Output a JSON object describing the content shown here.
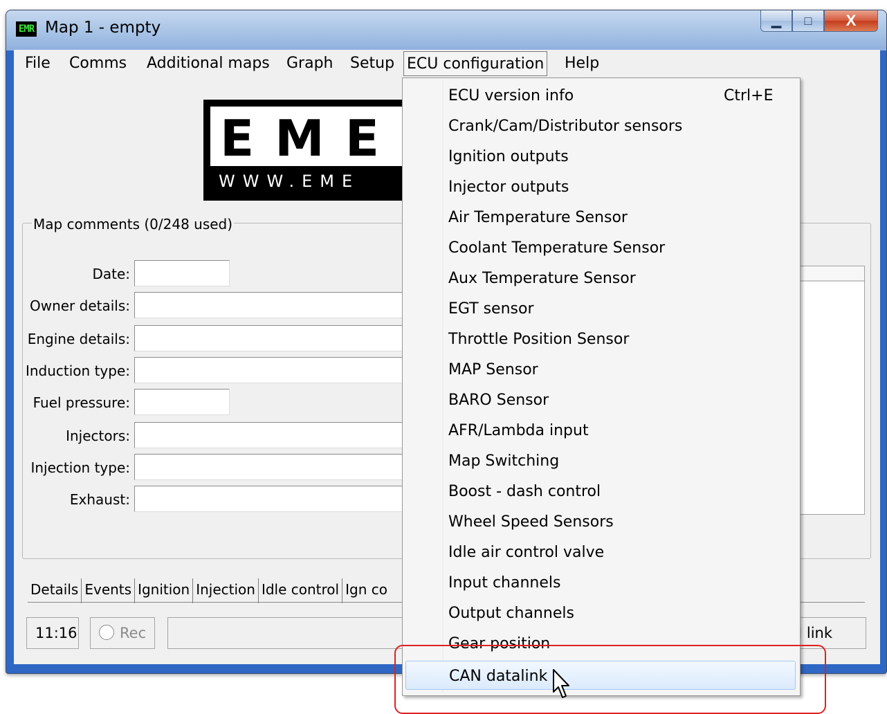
{
  "window": {
    "icon_text": "EMR",
    "title": "Map 1 - empty",
    "minimize_glyph": "▁",
    "maximize_glyph": "□",
    "close_glyph": "X"
  },
  "menu": {
    "items": [
      "File",
      "Comms",
      "Additional maps",
      "Graph",
      "Setup",
      "ECU configuration",
      "Help"
    ],
    "active": "ECU configuration"
  },
  "logo": {
    "letters": "EME",
    "url": "WWW.EME"
  },
  "map_comments": {
    "legend": "Map comments (0/248 used)",
    "fields": [
      {
        "label": "Date:",
        "value": ""
      },
      {
        "label": "Owner details:",
        "value": ""
      },
      {
        "label": "Engine details:",
        "value": ""
      },
      {
        "label": "Induction type:",
        "value": ""
      },
      {
        "label": "Fuel pressure:",
        "value": ""
      },
      {
        "label": "Injectors:",
        "value": ""
      },
      {
        "label": "Injection type:",
        "value": ""
      },
      {
        "label": "Exhaust:",
        "value": ""
      }
    ]
  },
  "tabs": [
    "Details",
    "Events",
    "Ignition",
    "Injection",
    "Idle control",
    "Ign co"
  ],
  "status": {
    "time": "11:16",
    "rec_label": "Rec",
    "link_text": "J link"
  },
  "dropdown": {
    "items": [
      {
        "label": "ECU version info",
        "shortcut": "Ctrl+E"
      },
      {
        "label": "Crank/Cam/Distributor sensors",
        "shortcut": ""
      },
      {
        "label": "Ignition outputs",
        "shortcut": ""
      },
      {
        "label": "Injector outputs",
        "shortcut": ""
      },
      {
        "label": "Air Temperature Sensor",
        "shortcut": ""
      },
      {
        "label": "Coolant Temperature Sensor",
        "shortcut": ""
      },
      {
        "label": "Aux Temperature Sensor",
        "shortcut": ""
      },
      {
        "label": "EGT sensor",
        "shortcut": ""
      },
      {
        "label": "Throttle Position Sensor",
        "shortcut": ""
      },
      {
        "label": "MAP Sensor",
        "shortcut": ""
      },
      {
        "label": "BARO Sensor",
        "shortcut": ""
      },
      {
        "label": "AFR/Lambda input",
        "shortcut": ""
      },
      {
        "label": "Map Switching",
        "shortcut": ""
      },
      {
        "label": "Boost - dash control",
        "shortcut": ""
      },
      {
        "label": "Wheel Speed Sensors",
        "shortcut": ""
      },
      {
        "label": "Idle air control valve",
        "shortcut": ""
      },
      {
        "label": "Input channels",
        "shortcut": ""
      },
      {
        "label": "Output channels",
        "shortcut": ""
      },
      {
        "label": "Gear position",
        "shortcut": ""
      },
      {
        "label": "CAN datalink",
        "shortcut": ""
      }
    ],
    "highlighted": "CAN datalink"
  },
  "annotation": {
    "color": "#e02020"
  }
}
